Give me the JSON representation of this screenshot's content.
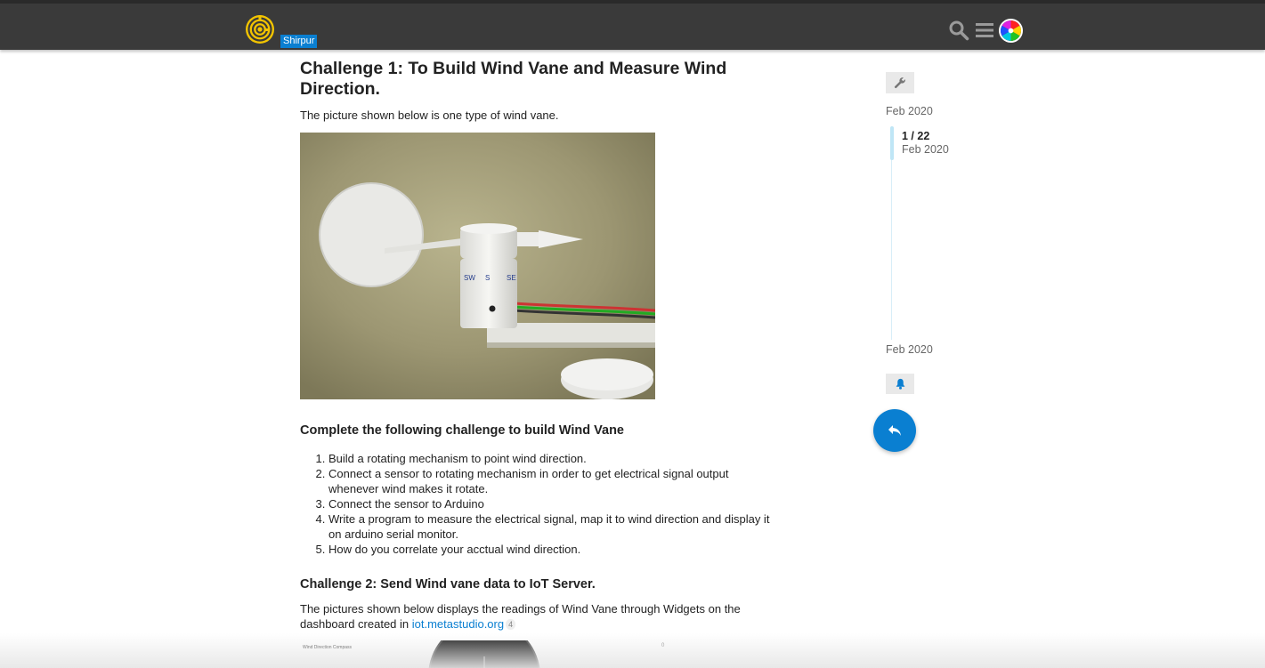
{
  "header": {
    "site_badge": "Shirpur",
    "icons": [
      "logo-icon",
      "search-icon",
      "hamburger-menu-icon",
      "avatar"
    ],
    "background_color": "#3a3a3a",
    "badge_color": "#0a7fd1"
  },
  "post": {
    "title": "Challenge 1: To Build Wind Vane and Measure Wind Direction.",
    "intro": "The picture shown below is one type of wind vane.",
    "image_labels": [
      "SW",
      "S",
      "SE"
    ],
    "section1_heading": "Complete the following challenge to build Wind Vane",
    "steps": [
      "Build a rotating mechanism to point wind direction.",
      "Connect a sensor to rotating mechanism in order to get electrical signal output whenever wind makes it rotate.",
      "Connect the sensor to Arduino",
      "Write a program to measure the electrical signal, map it to wind direction and display it on arduino serial monitor.",
      "How do you correlate your acctual wind direction."
    ],
    "section2_heading": "Challenge 2: Send Wind vane data to IoT Server.",
    "para2_text": "The pictures shown below displays the readings of Wind Vane through Widgets on the dashboard created in ",
    "link_text": "iot.metastudio.org",
    "link_count": "4",
    "widget_title": "Wind Direction Compass",
    "widget_dot": "0"
  },
  "timeline": {
    "start_date": "Feb 2020",
    "position": "1 / 22",
    "position_date": "Feb 2020",
    "end_date": "Feb 2020",
    "accent_color": "#0a7fd1"
  }
}
